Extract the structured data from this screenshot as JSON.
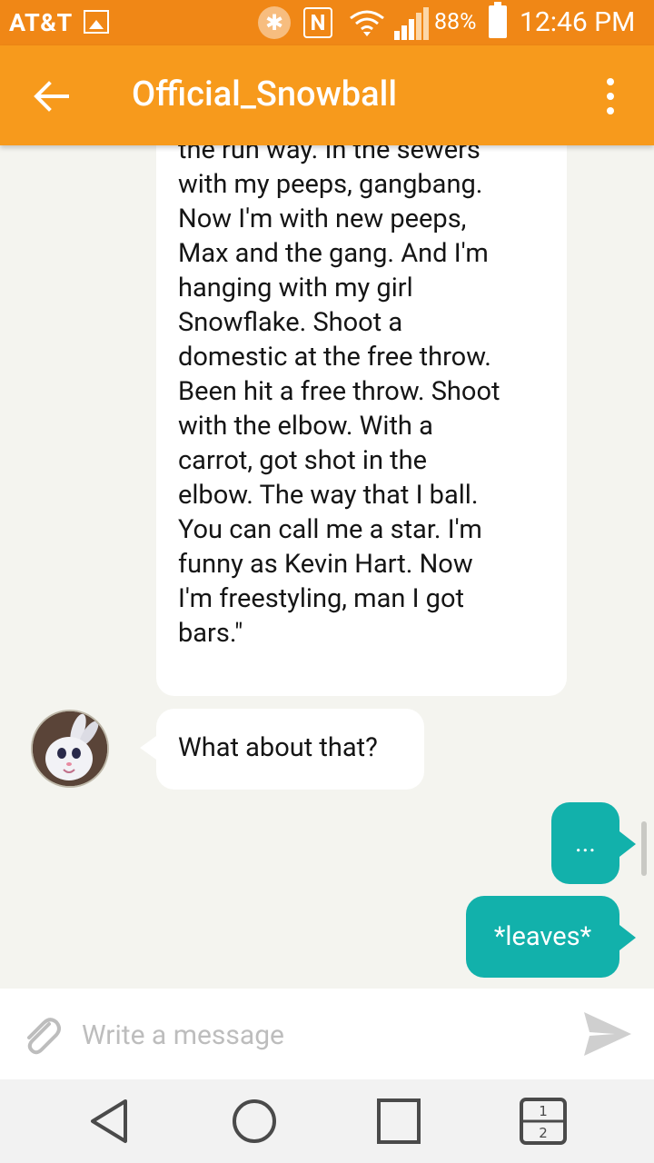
{
  "status_bar": {
    "carrier": "AT&T",
    "battery_percent": "88%",
    "time": "12:46 PM",
    "nfc_label": "N"
  },
  "app_bar": {
    "title": "Official_Snowball"
  },
  "messages": [
    {
      "from": "contact",
      "text": "call Kanye. I used to trap at\nthe run way. In the sewers\nwith my peeps, gangbang.\nNow I'm with new peeps,\nMax and the gang. And I'm\nhanging with my girl\nSnowflake. Shoot a\ndomestic at the free throw.\nBeen hit a free throw. Shoot\nwith the elbow. With a\ncarrot, got shot in the\nelbow. The way that I ball.\nYou can call me a star. I'm\nfunny as Kevin Hart. Now\nI'm freestyling, man I got\nbars.\""
    },
    {
      "from": "contact",
      "text": "What about that?"
    },
    {
      "from": "me",
      "text": "..."
    },
    {
      "from": "me",
      "text": "*leaves*"
    }
  ],
  "composer": {
    "placeholder": "Write a message"
  },
  "nav": {
    "switch_top": "1",
    "switch_bottom": "2"
  },
  "colors": {
    "status_bar": "#f08716",
    "app_bar": "#f79a1c",
    "outgoing_bubble": "#12b1ab",
    "incoming_bubble": "#ffffff",
    "background": "#f4f4ef"
  }
}
